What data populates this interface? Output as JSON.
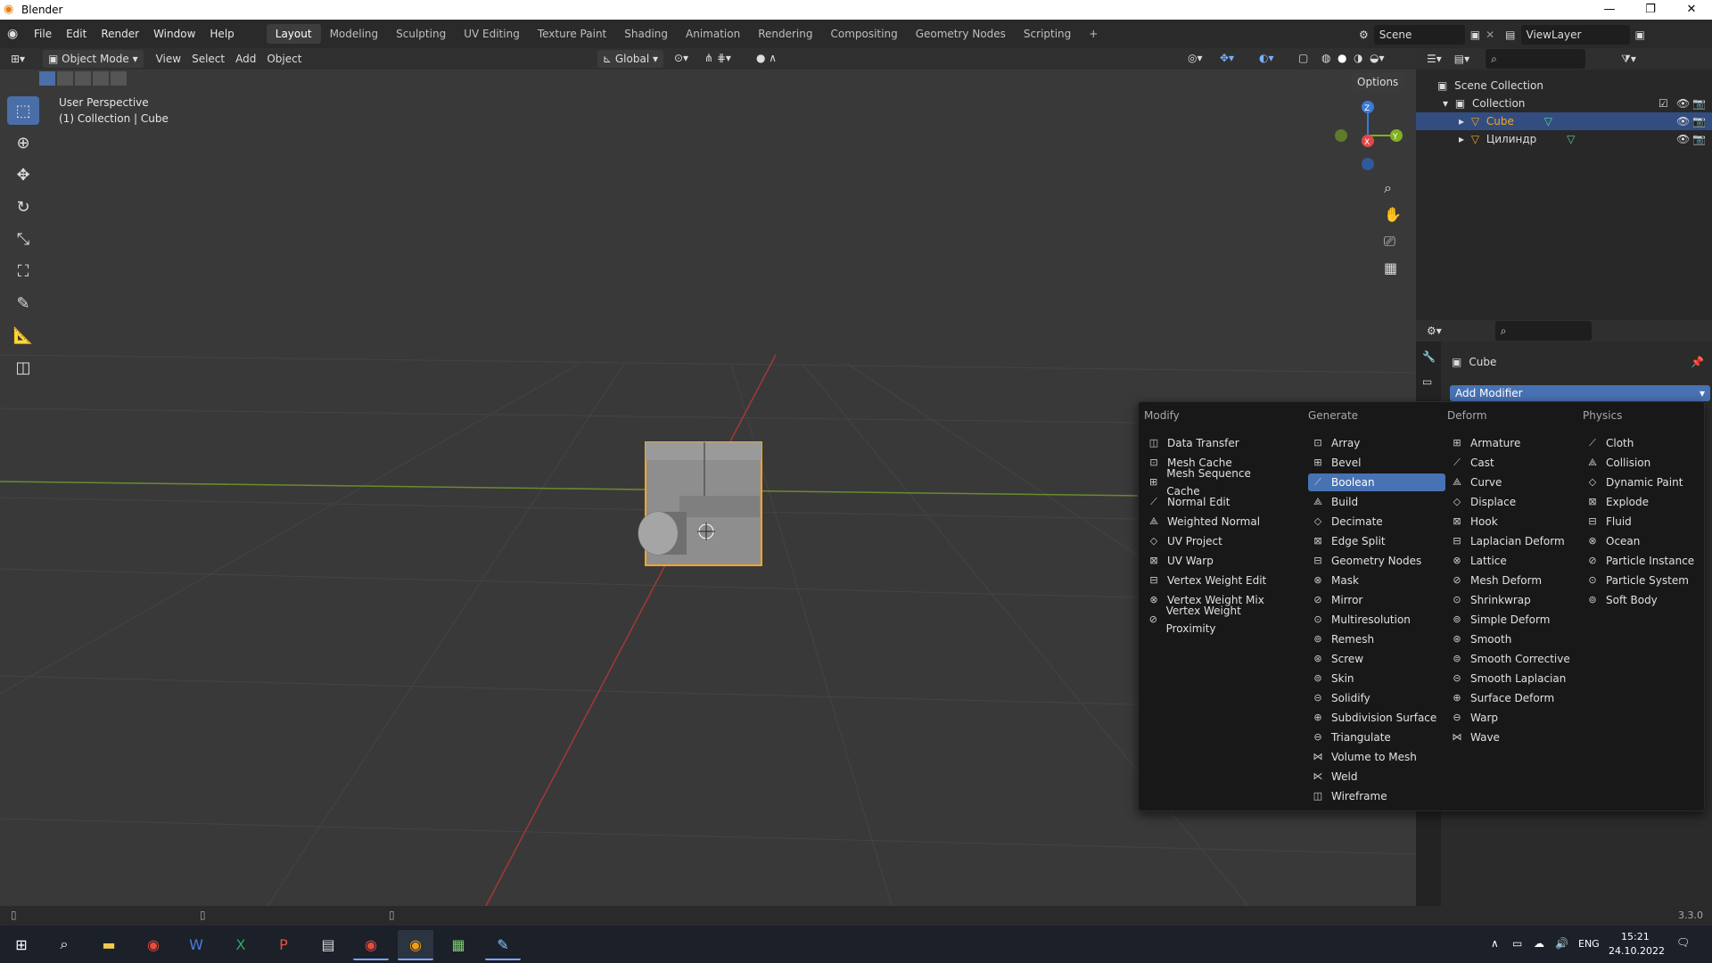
{
  "window": {
    "title": "Blender",
    "minimize": "—",
    "maximize": "❐",
    "close": "✕"
  },
  "menu": [
    "File",
    "Edit",
    "Render",
    "Window",
    "Help"
  ],
  "workspaces": [
    "Layout",
    "Modeling",
    "Sculpting",
    "UV Editing",
    "Texture Paint",
    "Shading",
    "Animation",
    "Rendering",
    "Compositing",
    "Geometry Nodes",
    "Scripting"
  ],
  "add_workspace": "+",
  "scene": {
    "label": "Scene",
    "view_layer": "ViewLayer"
  },
  "viewport_header": {
    "mode": "Object Mode",
    "items": [
      "View",
      "Select",
      "Add",
      "Object"
    ],
    "transform": "Global",
    "options": "Options"
  },
  "viewport": {
    "perspective": "User Perspective",
    "context": "(1) Collection | Cube",
    "gizmo": {
      "z": "Z",
      "y": "Y",
      "x": "X"
    }
  },
  "outliner": {
    "scene_collection": "Scene Collection",
    "collection": "Collection",
    "objects": [
      "Cube",
      "Цилиндр"
    ]
  },
  "properties": {
    "object_name": "Cube",
    "add_modifier": "Add Modifier"
  },
  "modifier_menu": {
    "columns": [
      {
        "title": "Modify",
        "items": [
          "Data Transfer",
          "Mesh Cache",
          "Mesh Sequence Cache",
          "Normal Edit",
          "Weighted Normal",
          "UV Project",
          "UV Warp",
          "Vertex Weight Edit",
          "Vertex Weight Mix",
          "Vertex Weight Proximity"
        ]
      },
      {
        "title": "Generate",
        "items": [
          "Array",
          "Bevel",
          "Boolean",
          "Build",
          "Decimate",
          "Edge Split",
          "Geometry Nodes",
          "Mask",
          "Mirror",
          "Multiresolution",
          "Remesh",
          "Screw",
          "Skin",
          "Solidify",
          "Subdivision Surface",
          "Triangulate",
          "Volume to Mesh",
          "Weld",
          "Wireframe"
        ]
      },
      {
        "title": "Deform",
        "items": [
          "Armature",
          "Cast",
          "Curve",
          "Displace",
          "Hook",
          "Laplacian Deform",
          "Lattice",
          "Mesh Deform",
          "Shrinkwrap",
          "Simple Deform",
          "Smooth",
          "Smooth Corrective",
          "Smooth Laplacian",
          "Surface Deform",
          "Warp",
          "Wave"
        ]
      },
      {
        "title": "Physics",
        "items": [
          "Cloth",
          "Collision",
          "Dynamic Paint",
          "Explode",
          "Fluid",
          "Ocean",
          "Particle Instance",
          "Particle System",
          "Soft Body"
        ]
      }
    ],
    "highlighted": "Boolean"
  },
  "status": {
    "version": "3.3.0"
  },
  "taskbar": {
    "lang": "ENG",
    "time": "15:21",
    "date": "24.10.2022"
  },
  "colors": {
    "accent": "#4772b3",
    "selection_orange": "#f5a623"
  }
}
